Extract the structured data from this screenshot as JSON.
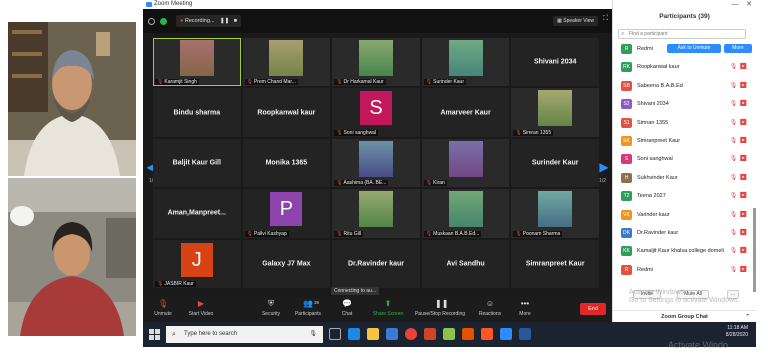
{
  "window_title": "Zoom Meeting",
  "recording_label": "Recording...",
  "speaker_view_label": "Speaker View",
  "grid": [
    {
      "type": "video",
      "label": "Karamjit Singh",
      "active": true,
      "bg": "#3c4a3a"
    },
    {
      "type": "video",
      "label": "Prem Chand Mar..."
    },
    {
      "type": "video",
      "label": "Dr Harkamal Kaur"
    },
    {
      "type": "video",
      "label": "Surinder Kaur"
    },
    {
      "type": "name",
      "name": "Shivani 2034"
    },
    {
      "type": "name",
      "name": "Bindu sharma"
    },
    {
      "type": "name",
      "name": "Roopkanwal kaur"
    },
    {
      "type": "letter",
      "letter": "S",
      "letter_color": "#c2185b",
      "label": "Soni sanghwal"
    },
    {
      "type": "name",
      "name": "Amarveer Kaur"
    },
    {
      "type": "video",
      "label": "Simran 1355"
    },
    {
      "type": "name",
      "name": "Baljit Kaur Gill"
    },
    {
      "type": "name",
      "name": "Monika 1365"
    },
    {
      "type": "video",
      "label": "Aashima (BA. BE..."
    },
    {
      "type": "video",
      "label": "Kiran"
    },
    {
      "type": "name",
      "name": "Surinder Kaur"
    },
    {
      "type": "name",
      "name": "Aman,Manpreet..."
    },
    {
      "type": "letter",
      "letter": "P",
      "letter_color": "#8e44ad",
      "label": "Pallvi Kashyap"
    },
    {
      "type": "video",
      "label": "Ritu Gill"
    },
    {
      "type": "video",
      "label": "Muskaan B.A.B.Ed..."
    },
    {
      "type": "video",
      "label": "Poonam Sharma"
    },
    {
      "type": "letter",
      "letter": "J",
      "letter_color": "#d84315",
      "label": "JASBIR Kaur"
    },
    {
      "type": "name",
      "name": "Galaxy J7 Max"
    },
    {
      "type": "name",
      "name": "Dr.Ravinder kaur"
    },
    {
      "type": "name",
      "name": "Avi Sandhu"
    },
    {
      "type": "name",
      "name": "Simranpreet Kaur"
    }
  ],
  "page_indicator": "1/2",
  "toolbar": {
    "unmute": "Unmute",
    "start_video": "Start Video",
    "security": "Security",
    "participants": "Participants",
    "participants_count": "39",
    "chat": "Chat",
    "share_screen": "Share Screen",
    "record": "Pause/Stop Recording",
    "reactions": "Reactions",
    "more": "More",
    "end": "End"
  },
  "tooltip": "Connecting to au...",
  "panel": {
    "title": "Participants (39)",
    "search_placeholder": "Find a participant",
    "ask_unmute": "Ask to Unmute",
    "more": "More",
    "invite": "Invite",
    "mute_all": "Mute All",
    "more_dots": "...",
    "group_chat": "Zoom Group Chat",
    "participants": [
      {
        "initials": "R",
        "name": "Redmi",
        "color": "#2e9e5b"
      },
      {
        "initials": "RK",
        "name": "Roopkanwal kaur",
        "color": "#2e9e5b"
      },
      {
        "initials": "SB",
        "name": "Sabeena B.A.B.Ed",
        "color": "#e25141"
      },
      {
        "initials": "S2",
        "name": "Shivani 2034",
        "color": "#8e5ac8"
      },
      {
        "initials": "S1",
        "name": "Simran 1355",
        "color": "#e25141"
      },
      {
        "initials": "SK",
        "name": "Simranpreet Kaur",
        "color": "#f29320"
      },
      {
        "initials": "S",
        "name": "Soni sanghwal",
        "color": "#d63a7a"
      },
      {
        "initials": "H",
        "name": "Sukhvinder Kaur",
        "color": "#8b6f4e"
      },
      {
        "initials": "T2",
        "name": "Teena 2027",
        "color": "#2e9e5b"
      },
      {
        "initials": "VK",
        "name": "Varinder kaur",
        "color": "#f29320"
      },
      {
        "initials": "DK",
        "name": "Dr.Ravinder kaur",
        "color": "#3a78c9"
      },
      {
        "initials": "KK",
        "name": "Kamaljit Kaur khalsa college domeli",
        "color": "#2e9e5b"
      },
      {
        "initials": "R",
        "name": "Redmi",
        "color": "#e25141"
      }
    ]
  },
  "watermark": "Activate Windows\nGo to Settings to activate Windows.",
  "taskbar": {
    "search_placeholder": "Type here to search",
    "time": "11:18 AM",
    "date": "8/28/2020"
  },
  "activate_overlay": "Activate Windo"
}
